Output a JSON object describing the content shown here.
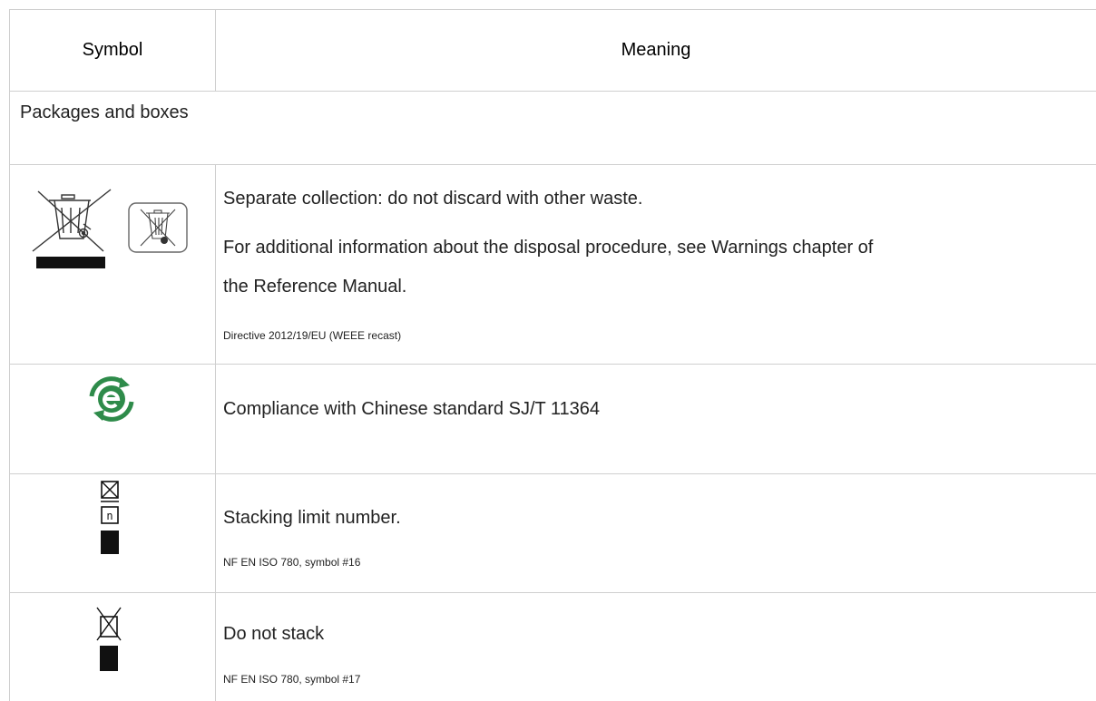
{
  "table": {
    "headers": {
      "symbol": "Symbol",
      "meaning": "Meaning"
    },
    "section": "Packages and boxes",
    "rows": [
      {
        "icons": [
          "crossed-wheeled-bin-icon",
          "crossed-bin-framed-icon"
        ],
        "lines": [
          "Separate collection: do not discard with other waste.",
          "For additional information about the disposal procedure, see Warnings chapter of",
          "the Reference Manual."
        ],
        "note": "Directive 2012/19/EU (WEEE recast)"
      },
      {
        "icons": [
          "china-rohs-e-icon"
        ],
        "lines": [
          "Compliance with Chinese standard SJ/T 11364"
        ],
        "note": ""
      },
      {
        "icons": [
          "stacking-limit-icon"
        ],
        "lines": [
          "Stacking limit number."
        ],
        "icon_text": "n",
        "note": "NF EN ISO 780, symbol #16"
      },
      {
        "icons": [
          "do-not-stack-icon"
        ],
        "lines": [
          "Do not stack"
        ],
        "note": "NF EN ISO 780, symbol #17"
      }
    ]
  },
  "colors": {
    "grid": "#cfcfcf",
    "rohs_green": "#2e8b4a"
  }
}
